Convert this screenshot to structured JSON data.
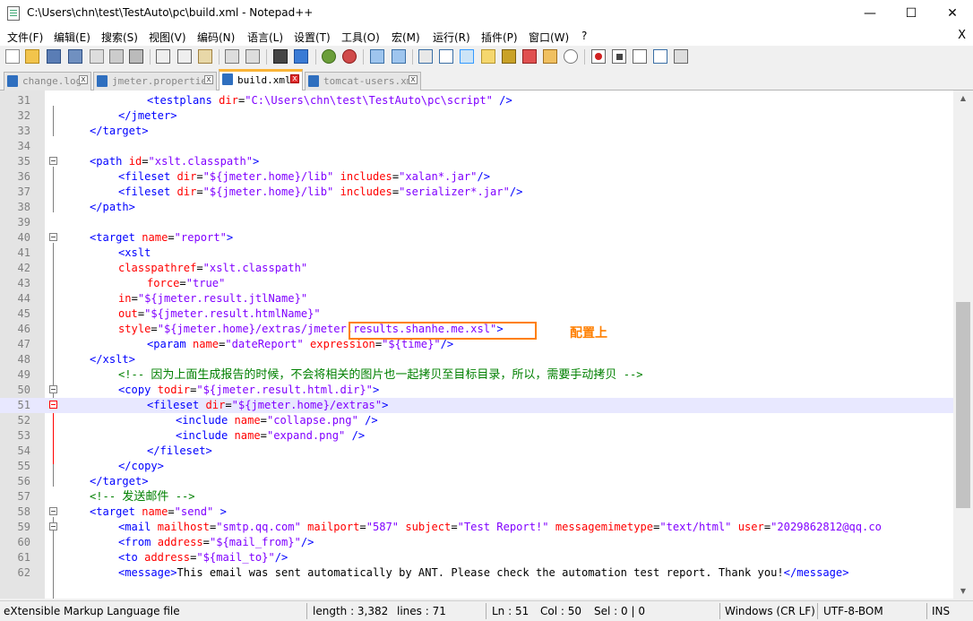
{
  "window": {
    "title": "C:\\Users\\chn\\test\\TestAuto\\pc\\build.xml - Notepad++",
    "minimize": "—",
    "maximize": "☐",
    "close": "✕"
  },
  "menu": {
    "items": [
      "文件(F)",
      "编辑(E)",
      "搜索(S)",
      "视图(V)",
      "编码(N)",
      "语言(L)",
      "设置(T)",
      "工具(O)",
      "宏(M)",
      "运行(R)",
      "插件(P)",
      "窗口(W)",
      "?"
    ],
    "close": "X"
  },
  "tabs": [
    {
      "label": "change.log",
      "active": false
    },
    {
      "label": "jmeter.properties",
      "active": false
    },
    {
      "label": "build.xml",
      "active": true
    },
    {
      "label": "tomcat-users.xml",
      "active": false
    }
  ],
  "editor": {
    "line_numbers": [
      "31",
      "32",
      "33",
      "34",
      "35",
      "36",
      "37",
      "38",
      "39",
      "40",
      "41",
      "42",
      "43",
      "44",
      "45",
      "46",
      "47",
      "48",
      "49",
      "50",
      "51",
      "52",
      "53",
      "54",
      "55",
      "56",
      "57",
      "58",
      "59",
      "60",
      "61",
      "62"
    ],
    "current_line": "51",
    "annotation": "配置上",
    "lines": {
      "l31": {
        "a": "<testplans ",
        "b": "dir",
        "c": "=",
        "d": "\"C:\\Users\\chn\\test\\TestAuto\\pc\\script\"",
        "e": " />"
      },
      "l32": {
        "a": "</jmeter>"
      },
      "l33": {
        "a": "</target>"
      },
      "l35": {
        "a": "<path ",
        "b": "id",
        "c": "=",
        "d": "\"xslt.classpath\"",
        "e": ">"
      },
      "l36": {
        "a": "<fileset ",
        "b": "dir",
        "c": "=",
        "d": "\"${jmeter.home}/lib\"",
        "e": " ",
        "f": "includes",
        "g": "=",
        "h": "\"xalan*.jar\"",
        "i": "/>"
      },
      "l37": {
        "a": "<fileset ",
        "b": "dir",
        "c": "=",
        "d": "\"${jmeter.home}/lib\"",
        "e": " ",
        "f": "includes",
        "g": "=",
        "h": "\"serializer*.jar\"",
        "i": "/>"
      },
      "l38": {
        "a": "</path>"
      },
      "l40": {
        "a": "<target ",
        "b": "name",
        "c": "=",
        "d": "\"report\"",
        "e": ">"
      },
      "l41": {
        "a": "<xslt"
      },
      "l42": {
        "b": "classpathref",
        "c": "=",
        "d": "\"xslt.classpath\""
      },
      "l43": {
        "b": "force",
        "c": "=",
        "d": "\"true\""
      },
      "l44": {
        "b": "in",
        "c": "=",
        "d": "\"${jmeter.result.jtlName}\""
      },
      "l45": {
        "b": "out",
        "c": "=",
        "d": "\"${jmeter.result.htmlName}\""
      },
      "l46": {
        "b": "style",
        "c": "=",
        "d": "\"${jmeter.home}/extras/jmeter.results.shanhe.me.xsl\"",
        "e": ">"
      },
      "l47": {
        "a": "<param ",
        "b": "name",
        "c": "=",
        "d": "\"dateReport\"",
        "e": " ",
        "f": "expression",
        "g": "=",
        "h": "\"${time}\"",
        "i": "/>"
      },
      "l48": {
        "a": "</xslt>"
      },
      "l49": {
        "a": "<!-- ",
        "cjk": "因为上面生成报告的时候，不会将相关的图片也一起拷贝至目标目录，所以，需要手动拷贝",
        "e": " -->"
      },
      "l50": {
        "a": "<copy ",
        "b": "todir",
        "c": "=",
        "d": "\"${jmeter.result.html.dir}\"",
        "e": ">"
      },
      "l51": {
        "a": "<fileset ",
        "b": "dir",
        "c": "=",
        "d": "\"${jmeter.home}/extras\"",
        "e": ">"
      },
      "l52": {
        "a": "<include ",
        "b": "name",
        "c": "=",
        "d": "\"collapse.png\"",
        "e": " />"
      },
      "l53": {
        "a": "<include ",
        "b": "name",
        "c": "=",
        "d": "\"expand.png\"",
        "e": " />"
      },
      "l54": {
        "a": "</fileset>"
      },
      "l55": {
        "a": "</copy>"
      },
      "l56": {
        "a": "</target>"
      },
      "l57": {
        "a": "<!-- ",
        "cjk": "发送邮件",
        "e": " -->"
      },
      "l58": {
        "a": "<target ",
        "b": "name",
        "c": "=",
        "d": "\"send\"",
        "e": " >"
      },
      "l59": {
        "a": "<mail ",
        "b1": "mailhost",
        "c1": "=",
        "d1": "\"smtp.qq.com\"",
        "b2": " mailport",
        "c2": "=",
        "d2": "\"587\"",
        "b3": " subject",
        "c3": "=",
        "d3": "\"Test Report!\"",
        "b4": " messagemimetype",
        "c4": "=",
        "d4": "\"text/html\"",
        "b5": " user",
        "c5": "=",
        "d5": "\"2029862812@qq.co"
      },
      "l60": {
        "a": "<from ",
        "b": "address",
        "c": "=",
        "d": "\"${mail_from}\"",
        "e": "/>"
      },
      "l61": {
        "a": "<to ",
        "b": "address",
        "c": "=",
        "d": "\"${mail_to}\"",
        "e": "/>"
      },
      "l62": {
        "a": "<message>",
        "t": "This email was sent automatically by ANT. Please check the automation test report. Thank you!",
        "e": "</message>"
      }
    }
  },
  "status": {
    "file_type": "eXtensible Markup Language file",
    "length": "length : 3,382",
    "lines": "lines : 71",
    "ln": "Ln : 51",
    "col": "Col : 50",
    "sel": "Sel : 0 | 0",
    "eol": "Windows (CR LF)",
    "encoding": "UTF-8-BOM",
    "mode": "INS"
  }
}
